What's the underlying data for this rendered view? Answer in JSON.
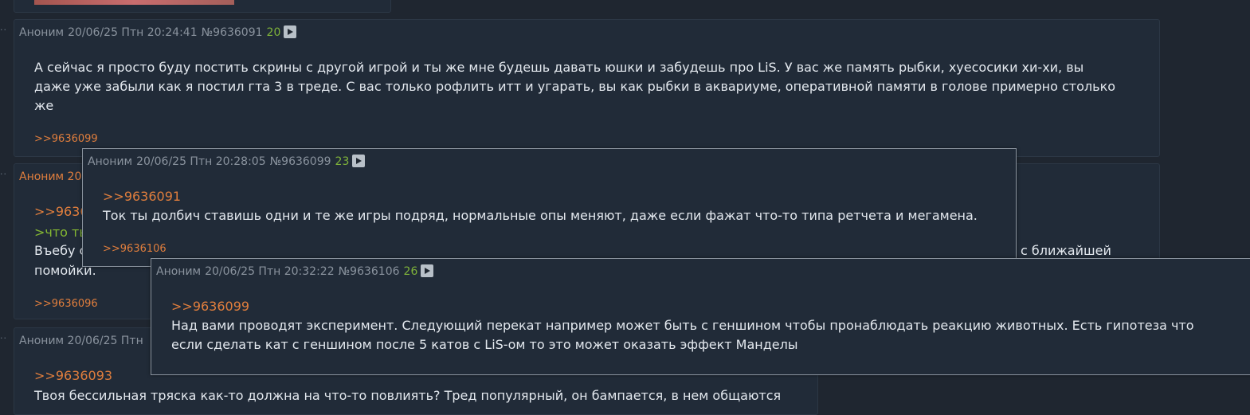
{
  "posts": {
    "p_top": {},
    "p91": {
      "name": "Аноним",
      "date": "20/06/25 Птн 20:24:41",
      "num": "№9636091",
      "count": "20",
      "line1": "А сейчас я просто буду постить скрины с другой игрой и ты же мне будешь давать юшки и забудешь про LiS. У вас же память рыбки, хуесосики хи-хи, вы",
      "line2": "даже уже забыли как я постил гта 3 в треде. С вас только рофлить итт и угарать, вы как рыбки в аквариуме, оперативной памяти в голове примерно столько",
      "line3": "же",
      "reply": ">>9636099"
    },
    "p_mid": {
      "name_fragment": "Аноним 20",
      "link_fragment": ">>9636",
      "green_fragment": ">что ты",
      "line_a_fragment": "Въебу с",
      "line_a_right": "с ближайшей",
      "line_b_fragment": "помойки.",
      "reply": ">>9636096"
    },
    "p_bot": {
      "header_fragment": "Аноним 20/06/25 Птн",
      "link": ">>9636093",
      "line1": "Твоя бессильная тряска как-то должна на что-то повлиять? Тред популярный, он бампается, в нем общаются"
    }
  },
  "popups": {
    "pop99": {
      "name": "Аноним",
      "date": "20/06/25 Птн 20:28:05",
      "num": "№9636099",
      "count": "23",
      "link": ">>9636091",
      "line1": "Ток ты долбич ставишь одни и те же игры подряд, нормальные опы меняют, даже если фажат что-то типа ретчета и мегамена.",
      "reply": ">>9636106"
    },
    "pop106": {
      "name": "Аноним",
      "date": "20/06/25 Птн 20:32:22",
      "num": "№9636106",
      "count": "26",
      "link": ">>9636099",
      "line1": "Над вами проводят эксперимент. Следующий перекат например может быть с геншином чтобы пронаблюдать реакцию животных. Есть гипотеза что",
      "line2": "если сделать кат с геншином после 5 катов с LiS-ом то это может оказать эффект Манделы"
    }
  }
}
